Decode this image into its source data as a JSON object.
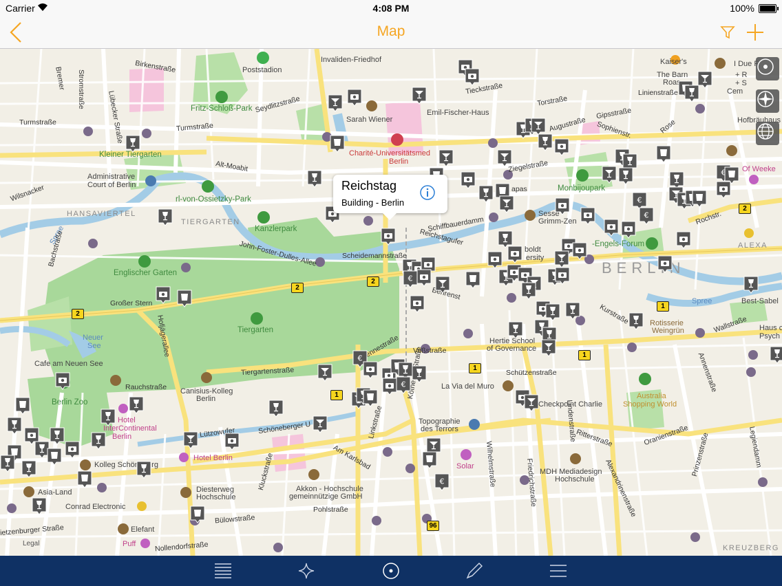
{
  "status_bar": {
    "carrier": "Carrier",
    "time": "4:08 PM",
    "battery": "100%"
  },
  "nav": {
    "title": "Map"
  },
  "callout": {
    "title": "Reichstag",
    "subtitle": "Building - Berlin"
  },
  "map_labels": {
    "poststadion": "Poststadion",
    "invaliden": "Invaliden-Friedhof",
    "fritz": "Fritz-Schloß-Park",
    "sarah": "Sarah Wiener",
    "emil": "Emil-Fischer-Haus",
    "charite1": "Charité-Universitätsmed",
    "charite2": "Berlin",
    "kleiner_tg": "Kleiner Tiergarten",
    "admin1": "Administrative",
    "admin2": "Court of Berlin",
    "ossietzky": "rl-von-Ossietzky-Park",
    "hansaviertel": "HANSAVIERTEL",
    "tiergarten_d": "TIERGARTEN",
    "kanzlerpark": "Kanzlerpark",
    "englischer": "Englischer Garten",
    "grosser_stern": "Großer Stern",
    "tiergarten": "Tiergarten",
    "neuer_see1": "Neuer",
    "neuer_see2": "See",
    "cafe": "Cafe am Neuen See",
    "berlin_zoo": "Berlin Zoo",
    "hotel_ic1": "Hotel",
    "hotel_ic2": "InterContinental",
    "hotel_ic3": "Berlin",
    "hotel_berlin": "Hotel Berlin",
    "kolleg": "Kolleg Schöneberg",
    "asia": "Asia-Land",
    "conrad": "Conrad Electronic",
    "elefant": "Elefant",
    "puff": "Puff",
    "diesterweg1": "Diesterweg",
    "diesterweg2": "Hochschule",
    "akkon1": "Akkon - Hochschule",
    "akkon2": "gemeinnützige GmbH",
    "canisius1": "Canisius-Kolleg",
    "canisius2": "Berlin",
    "topo1": "Topographie",
    "topo2": "des Terrors",
    "solar": "Solar",
    "hertie1": "Hertie School",
    "hertie2": "of Governance",
    "lavia": "La Via del Muro",
    "checkpoint": "Checkpoint Charlie",
    "australia1": "Australia",
    "australia2": "Shopping World",
    "mdh1": "MDH Mediadesign",
    "mdh2": "Hochschule",
    "monbijou": "Monbijoupark",
    "sessel1": "Sesse",
    "sessel2": "Grimm-Zen",
    "humboldt1": "boldt",
    "humboldt2": "ersity",
    "engels": "-Engels-Forum",
    "berlin": "BERLIN",
    "alexa": "ALEXA",
    "best_sabel": "Best-Sabel",
    "rotisserie1": "Rotisserie",
    "rotisserie2": "Weingrün",
    "haus1": "Haus c",
    "haus2": "Psych",
    "kaisers": "Kaiser's",
    "barn1": "The Barn",
    "barn2": "Roas",
    "idue": "I Due F",
    "rs1": "+ R",
    "rs2": "+ S",
    "rs3": "Cem",
    "hofbrau": "Hofbräuhaus Be",
    "ofweek": "Of Weeke",
    "kreuzberg": "KREUZBERG",
    "legal": "Legal",
    "spree1": "Spree",
    "spree2": "Spree"
  },
  "streets": {
    "stromstrasse": "Stromstraße",
    "birkenstrasse": "Birkenstraße",
    "luebecker": "Lübecker Straße",
    "turmstrasse1": "Turmstraße",
    "turmstrasse2": "Turmstraße",
    "seydlitz": "Seydlitzstraße",
    "bremer": "Bremer",
    "altmoabit": "Alt-Moabit",
    "wilsnacker": "Wilsnacker",
    "tieckstr": "Tieckstraße",
    "torstr": "Torstraße",
    "linienstr": "Linienstraße",
    "gipsstr": "Gipsstraße",
    "auguststr": "Augustraße",
    "sophienstr": "Sophienstr.",
    "ziegelstr": "Ziegelstraße",
    "apas": "apas",
    "schiffbauer": "Schiffbauerdamm",
    "reichstagufer": "Reichstagufer",
    "scheidemann": "Scheidemannstraße",
    "johnfoster": "John-Foster-Dulles-Allee",
    "bachstr": "Bachstraße",
    "hofjaeger": "Hofjägerallee",
    "tiergartenstr": "Tiergartenstraße",
    "rauchstr": "Rauchstraße",
    "luetzowufer": "Lützowufer",
    "schoeneberger": "Schöneberger U",
    "lennestr": "Lennestraße",
    "vossstr": "Voßstraße",
    "behrenstr": "Behrenst",
    "koethener": "Köthener Straße",
    "linkstr": "Linkstraße",
    "amkarlsbad": "Am Karlsbad",
    "kluckstr": "Kluckstraße",
    "pohlstr": "Pohlstraße",
    "buelowstr": "Bülowstraße",
    "nollendorf": "Nollendorfstraße",
    "kurfuersten": "ietzenburger Straße",
    "wilhelmstr": "Wilhelmstraße",
    "friedrichstr": "Friedrichstraße",
    "lindenstr": "Lindenstraße",
    "alexandrinen": "Alexandrinenstraße",
    "prinzenstr": "Prinzenstraße",
    "oranienstr": "Oranienstraße",
    "annenstr": "Annenstraße",
    "ritterstr": "Ritterstraße",
    "schuetzenstr": "Schützenstraße",
    "rochstr": "Rochstr.",
    "kurstr": "Kurstraße",
    "wallstr": "Wallstraße",
    "legiendamm": "Legiendamm",
    "rose": "Rose"
  },
  "routes": {
    "r2a": "2",
    "r2b": "2",
    "r2c": "2",
    "r2d": "2",
    "r1a": "1",
    "r1b": "1",
    "r1c": "1",
    "r1d": "1",
    "r96": "96"
  },
  "map_controls": [
    "locate-icon",
    "compass-icon",
    "globe-icon"
  ],
  "tabs": [
    "list-icon",
    "sparkle-icon",
    "locate-icon",
    "pen-icon",
    "menu-icon"
  ],
  "colors": {
    "accent": "#f5a623",
    "tabbar": "#0f3164",
    "marker": "#555555",
    "park": "#a8d89a",
    "water": "#a3cce6",
    "road": "#ffffff",
    "major_road": "#f9e27d",
    "info": "#2c7fd6"
  }
}
